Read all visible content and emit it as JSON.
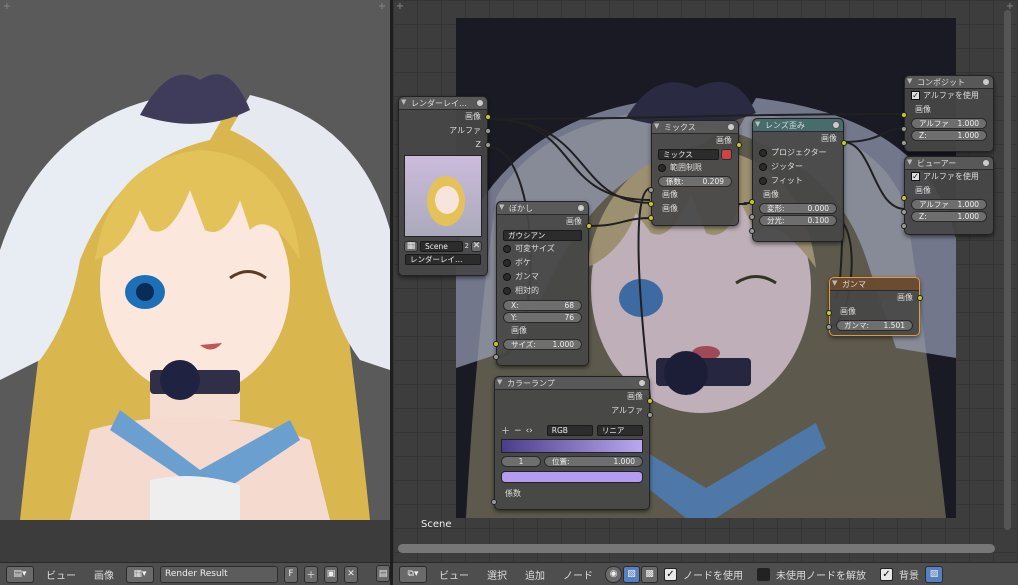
{
  "left_panel": {
    "header": {
      "menu_view": "ビュー",
      "menu_image": "画像",
      "image_name": "Render Result",
      "fake_user": "F"
    }
  },
  "node_editor": {
    "scene_label": "Scene",
    "header": {
      "menu_view": "ビュー",
      "menu_select": "選択",
      "menu_add": "追加",
      "menu_node": "ノード",
      "use_nodes_label": "ノードを使用",
      "free_unused_label": "未使用ノードを解放",
      "backdrop_label": "背景",
      "use_nodes": true,
      "free_unused": false,
      "backdrop": true
    },
    "nodes": {
      "render_layers": {
        "title": "レンダーレイ…",
        "out_image": "画像",
        "out_alpha": "アルファ",
        "out_z": "Z",
        "scene_name": "Scene",
        "scene_users": "2",
        "layer": "レンダーレイ…"
      },
      "blur": {
        "title": "ぼかし",
        "in_image_label": "画像",
        "filter": "ガウシアン",
        "variable_size": "可変サイズ",
        "bokeh": "ボケ",
        "gamma": "ガンマ",
        "relative": "相対的",
        "x_label": "X:",
        "x_value": "68",
        "y_label": "Y:",
        "y_value": "76",
        "out_image": "画像",
        "size_label": "サイズ:",
        "size_value": "1.000"
      },
      "mix": {
        "title": "ミックス",
        "out_image": "画像",
        "blend": "ミックス",
        "clamp": "範囲制限",
        "factor_label": "係数:",
        "factor_value": "0.209",
        "in_image1": "画像",
        "in_image2": "画像"
      },
      "lens": {
        "title": "レンズ歪み",
        "out_image": "画像",
        "projector": "プロジェクター",
        "jitter": "ジッター",
        "fit": "フィット",
        "in_image": "画像",
        "distort_label": "変形:",
        "distort_value": "0.000",
        "disp_label": "分光:",
        "disp_value": "0.100"
      },
      "composite": {
        "title": "コンポジット",
        "use_alpha": "アルファを使用",
        "in_image": "画像",
        "alpha_label": "アルファ",
        "alpha_value": "1.000",
        "z_label": "Z:",
        "z_value": "1.000"
      },
      "viewer": {
        "title": "ビューアー",
        "use_alpha": "アルファを使用",
        "in_image": "画像",
        "alpha_label": "アルファ",
        "alpha_value": "1.000",
        "z_label": "Z:",
        "z_value": "1.000"
      },
      "gamma": {
        "title": "ガンマ",
        "out_image": "画像",
        "gamma_label": "ガンマ:",
        "gamma_value": "1.501"
      },
      "color_ramp": {
        "title": "カラーランプ",
        "out_image": "画像",
        "out_alpha": "アルファ",
        "color_mode": "RGB",
        "interpolation": "リニア",
        "stop_index": "1",
        "pos_label": "位置:",
        "pos_value": "1.000",
        "in_factor": "係数",
        "ramp_start": "#4a3d8a",
        "ramp_end": "#b9a8f0",
        "stop_color": "#b49cf0"
      }
    }
  },
  "colors": {
    "socket_color": "#c7c729",
    "socket_value": "#999999",
    "gamma_border": "#e89a30"
  }
}
